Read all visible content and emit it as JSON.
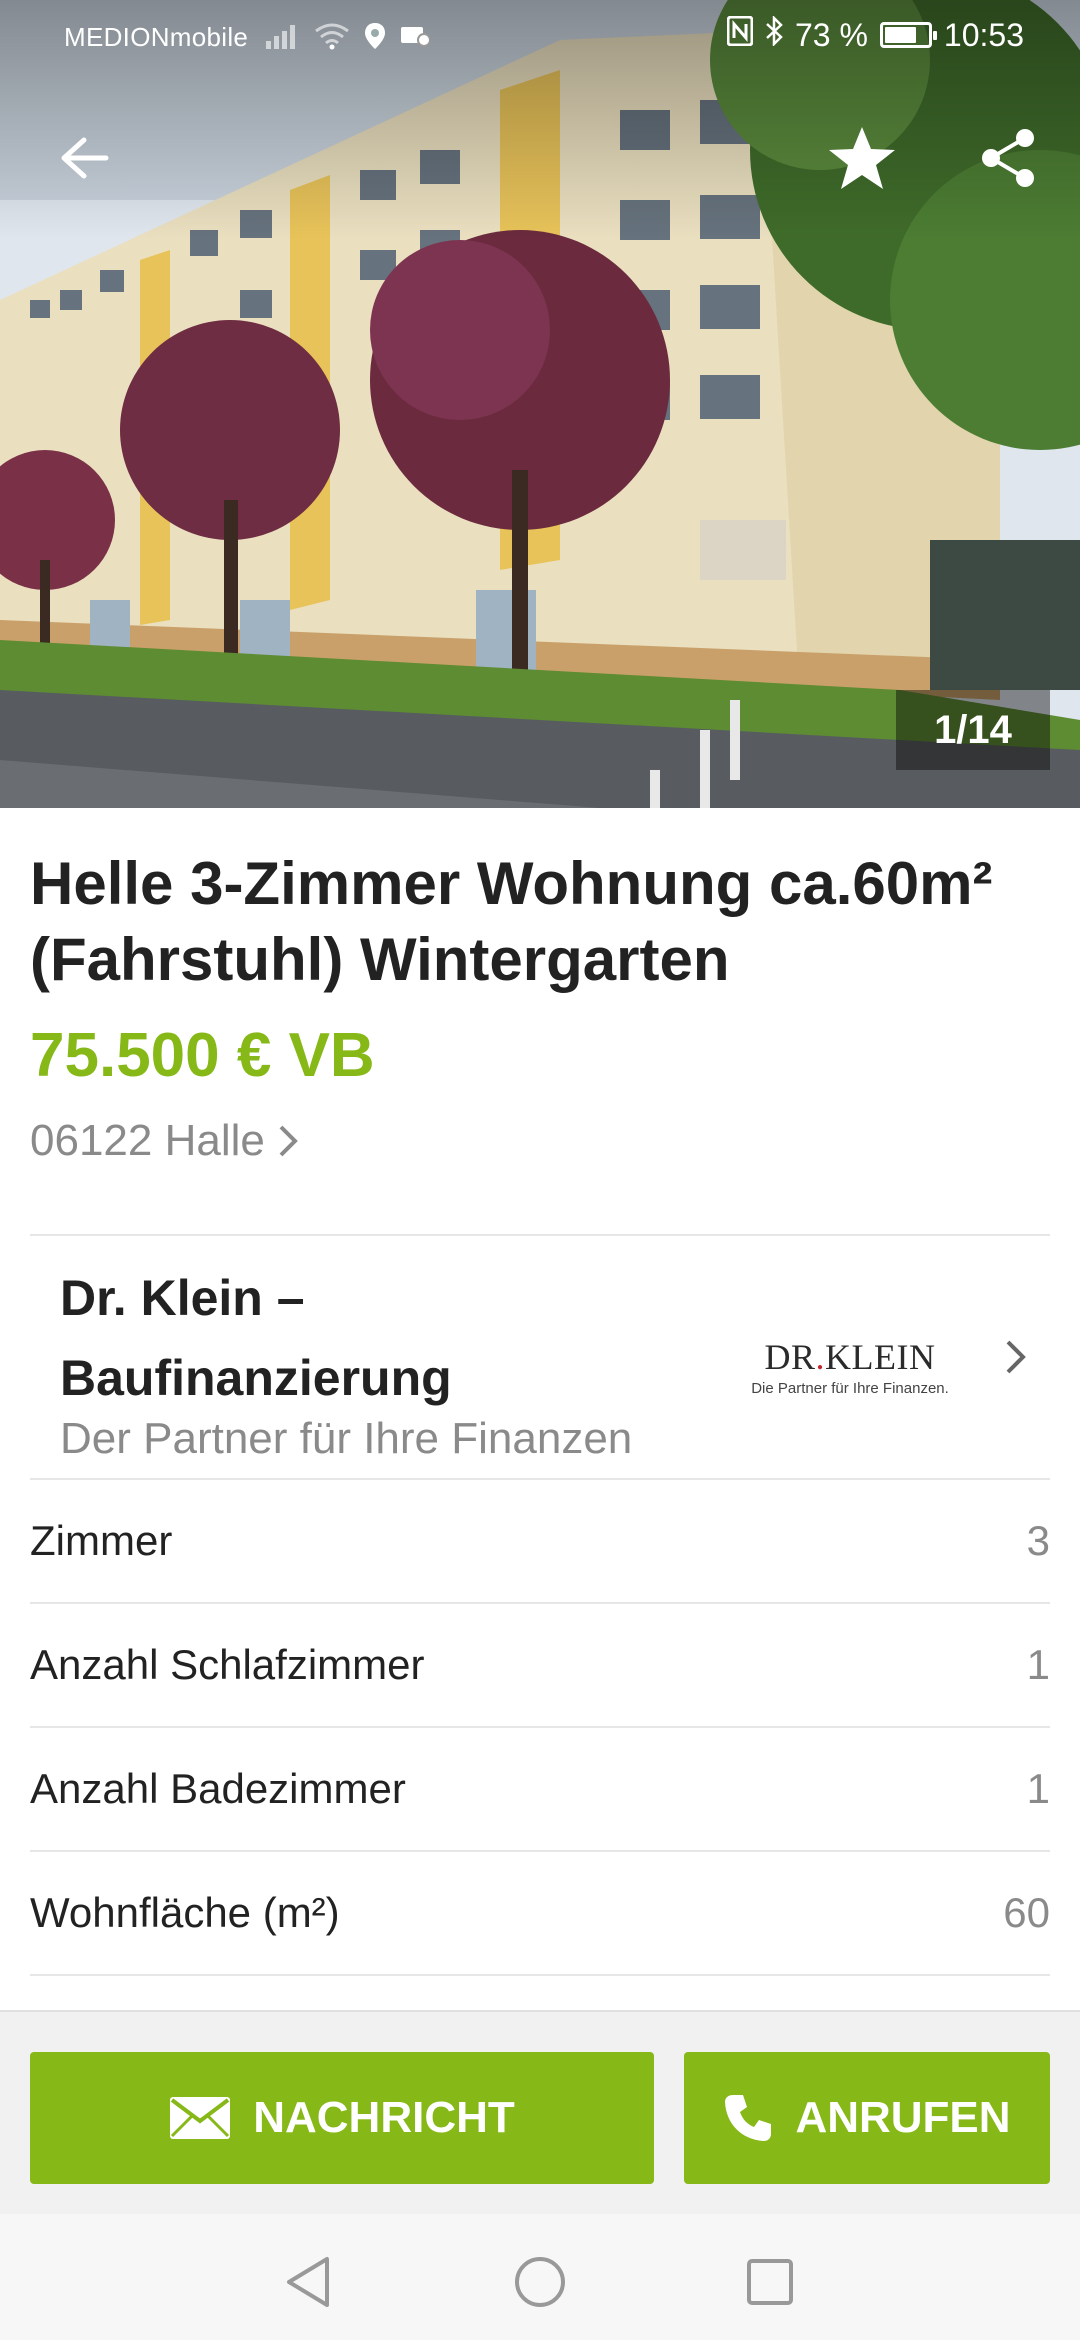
{
  "status_bar": {
    "carrier": "MEDIONmobile",
    "battery_text": "73 %",
    "battery_level": 0.73,
    "time": "10:53",
    "icons": [
      "signal-icon",
      "wifi-icon",
      "location-icon",
      "notification-icon",
      "nfc-icon",
      "bluetooth-icon",
      "battery-icon"
    ]
  },
  "gallery": {
    "counter": "1/14",
    "icons": [
      "back-arrow-icon",
      "star-icon",
      "share-icon"
    ]
  },
  "listing": {
    "title": "Helle 3-Zimmer Wohnung ca.60m² (Fahrstuhl) Wintergarten",
    "price": "75.500 € VB",
    "location": "06122 Halle"
  },
  "ad": {
    "title": "Dr. Klein – Baufinanzierung",
    "subtitle": "Der Partner für Ihre Finanzen",
    "logo_left": "DR",
    "logo_right": "KLEIN",
    "logo_tagline": "Die Partner für Ihre Finanzen.",
    "logo_dot_color": "#c0282d"
  },
  "attributes": [
    {
      "label": "Zimmer",
      "value": "3"
    },
    {
      "label": "Anzahl Schlafzimmer",
      "value": "1"
    },
    {
      "label": "Anzahl Badezimmer",
      "value": "1"
    },
    {
      "label": "Wohnfläche (m²)",
      "value": "60"
    }
  ],
  "actions": {
    "message_label": "NACHRICHT",
    "call_label": "ANRUFEN"
  },
  "colors": {
    "accent": "#86b817",
    "secondary_text": "#8a8a8a"
  }
}
